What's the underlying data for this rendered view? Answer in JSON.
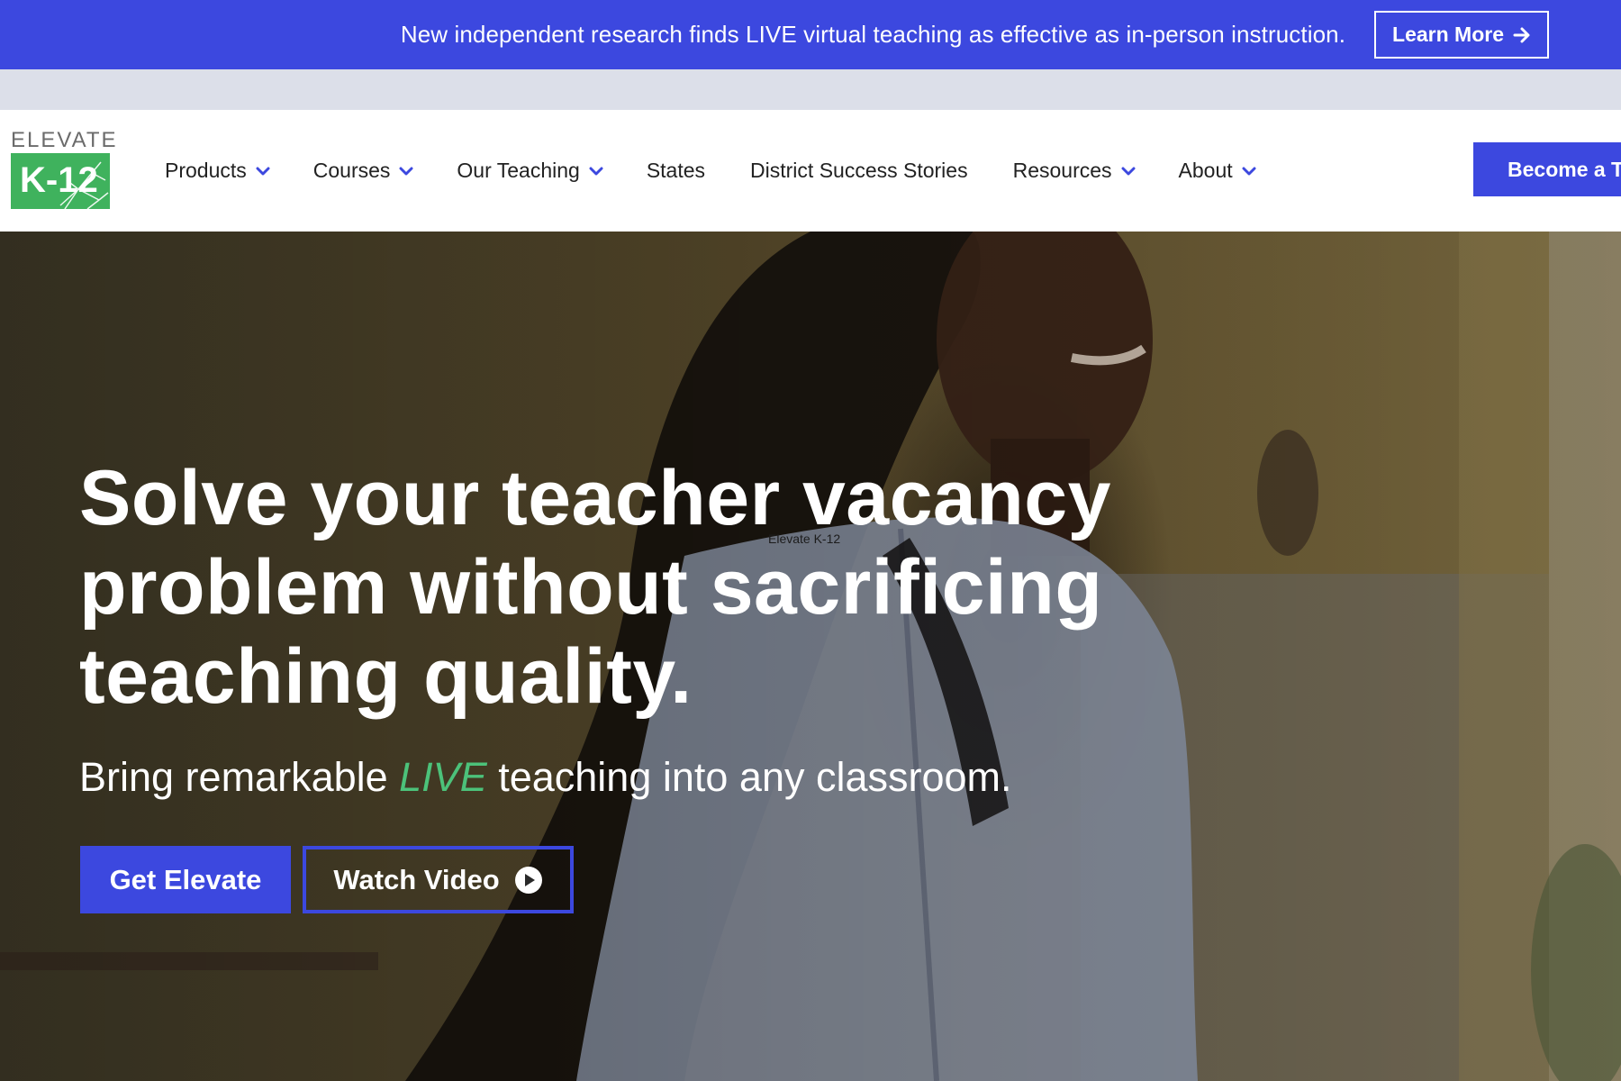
{
  "banner": {
    "text": "New independent research finds LIVE virtual teaching as effective as in-person instruction.",
    "button_label": "Learn More",
    "button_icon": "arrow-right-icon",
    "background": "#3c48df"
  },
  "logo": {
    "word": "ELEVATE",
    "mark": "K-12",
    "color": "#3fb25d"
  },
  "nav": {
    "items": [
      {
        "label": "Products",
        "icon": "chevron-down-icon"
      },
      {
        "label": "Courses",
        "icon": "chevron-down-icon"
      },
      {
        "label": "Our Teaching",
        "icon": "chevron-down-icon"
      },
      {
        "label": "States"
      },
      {
        "label": "District Success Stories"
      },
      {
        "label": "Resources",
        "icon": "chevron-down-icon"
      },
      {
        "label": "About",
        "icon": "chevron-down-icon"
      }
    ],
    "cta_label": "Become a T"
  },
  "hero": {
    "overlay_label": "Elevate K-12",
    "title": "Solve your teacher vacancy problem without sacrificing teaching quality.",
    "subtitle_before": "Bring remarkable ",
    "subtitle_live": "LIVE",
    "subtitle_after": " teaching into any classroom.",
    "primary_button": "Get Elevate",
    "secondary_button": "Watch Video",
    "secondary_icon": "play-circle-icon",
    "accent": "#4cc27a"
  }
}
